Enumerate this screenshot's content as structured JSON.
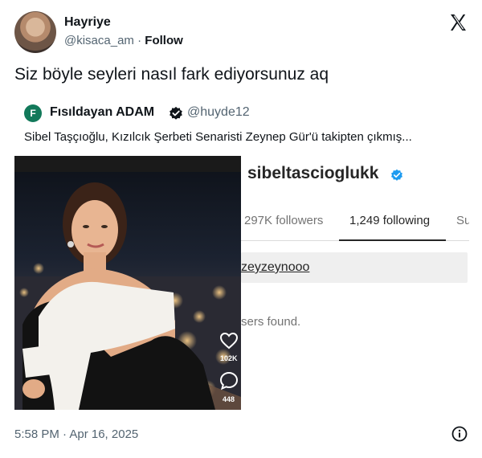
{
  "author": {
    "name": "Hayriye",
    "handle": "@kisaca_am",
    "separator": "·",
    "follow_label": "Follow"
  },
  "platform_icon": "x-logo-icon",
  "tweet": {
    "text": "Siz böyle seyleri nasıl fark ediyorsunuz aq"
  },
  "quoted_tweet": {
    "avatar_letter": "F",
    "name": "Fısıldayan ADAM",
    "handle": "@huyde12",
    "text": "Sibel Taşçıoğlu, Kızılcık Şerbeti Senaristi Zeynep Gür'ü takipten çıkmış...",
    "media": {
      "photo_overlay": {
        "like_count": "102K",
        "comment_count": "448"
      },
      "instagram": {
        "username": "sibeltascioglukk",
        "followers_tab": "297K followers",
        "following_tab": "1,249 following",
        "more_tab": "Su",
        "search_query": "zeyzeynooo",
        "empty_text": "sers found."
      }
    }
  },
  "footer": {
    "timestamp": "5:58 PM · Apr 16, 2025",
    "info_icon": "info-icon"
  },
  "colors": {
    "text_primary": "#0f1419",
    "text_secondary": "#536471",
    "verified_blue": "#1d9bf0",
    "ig_gray": "#737373"
  }
}
